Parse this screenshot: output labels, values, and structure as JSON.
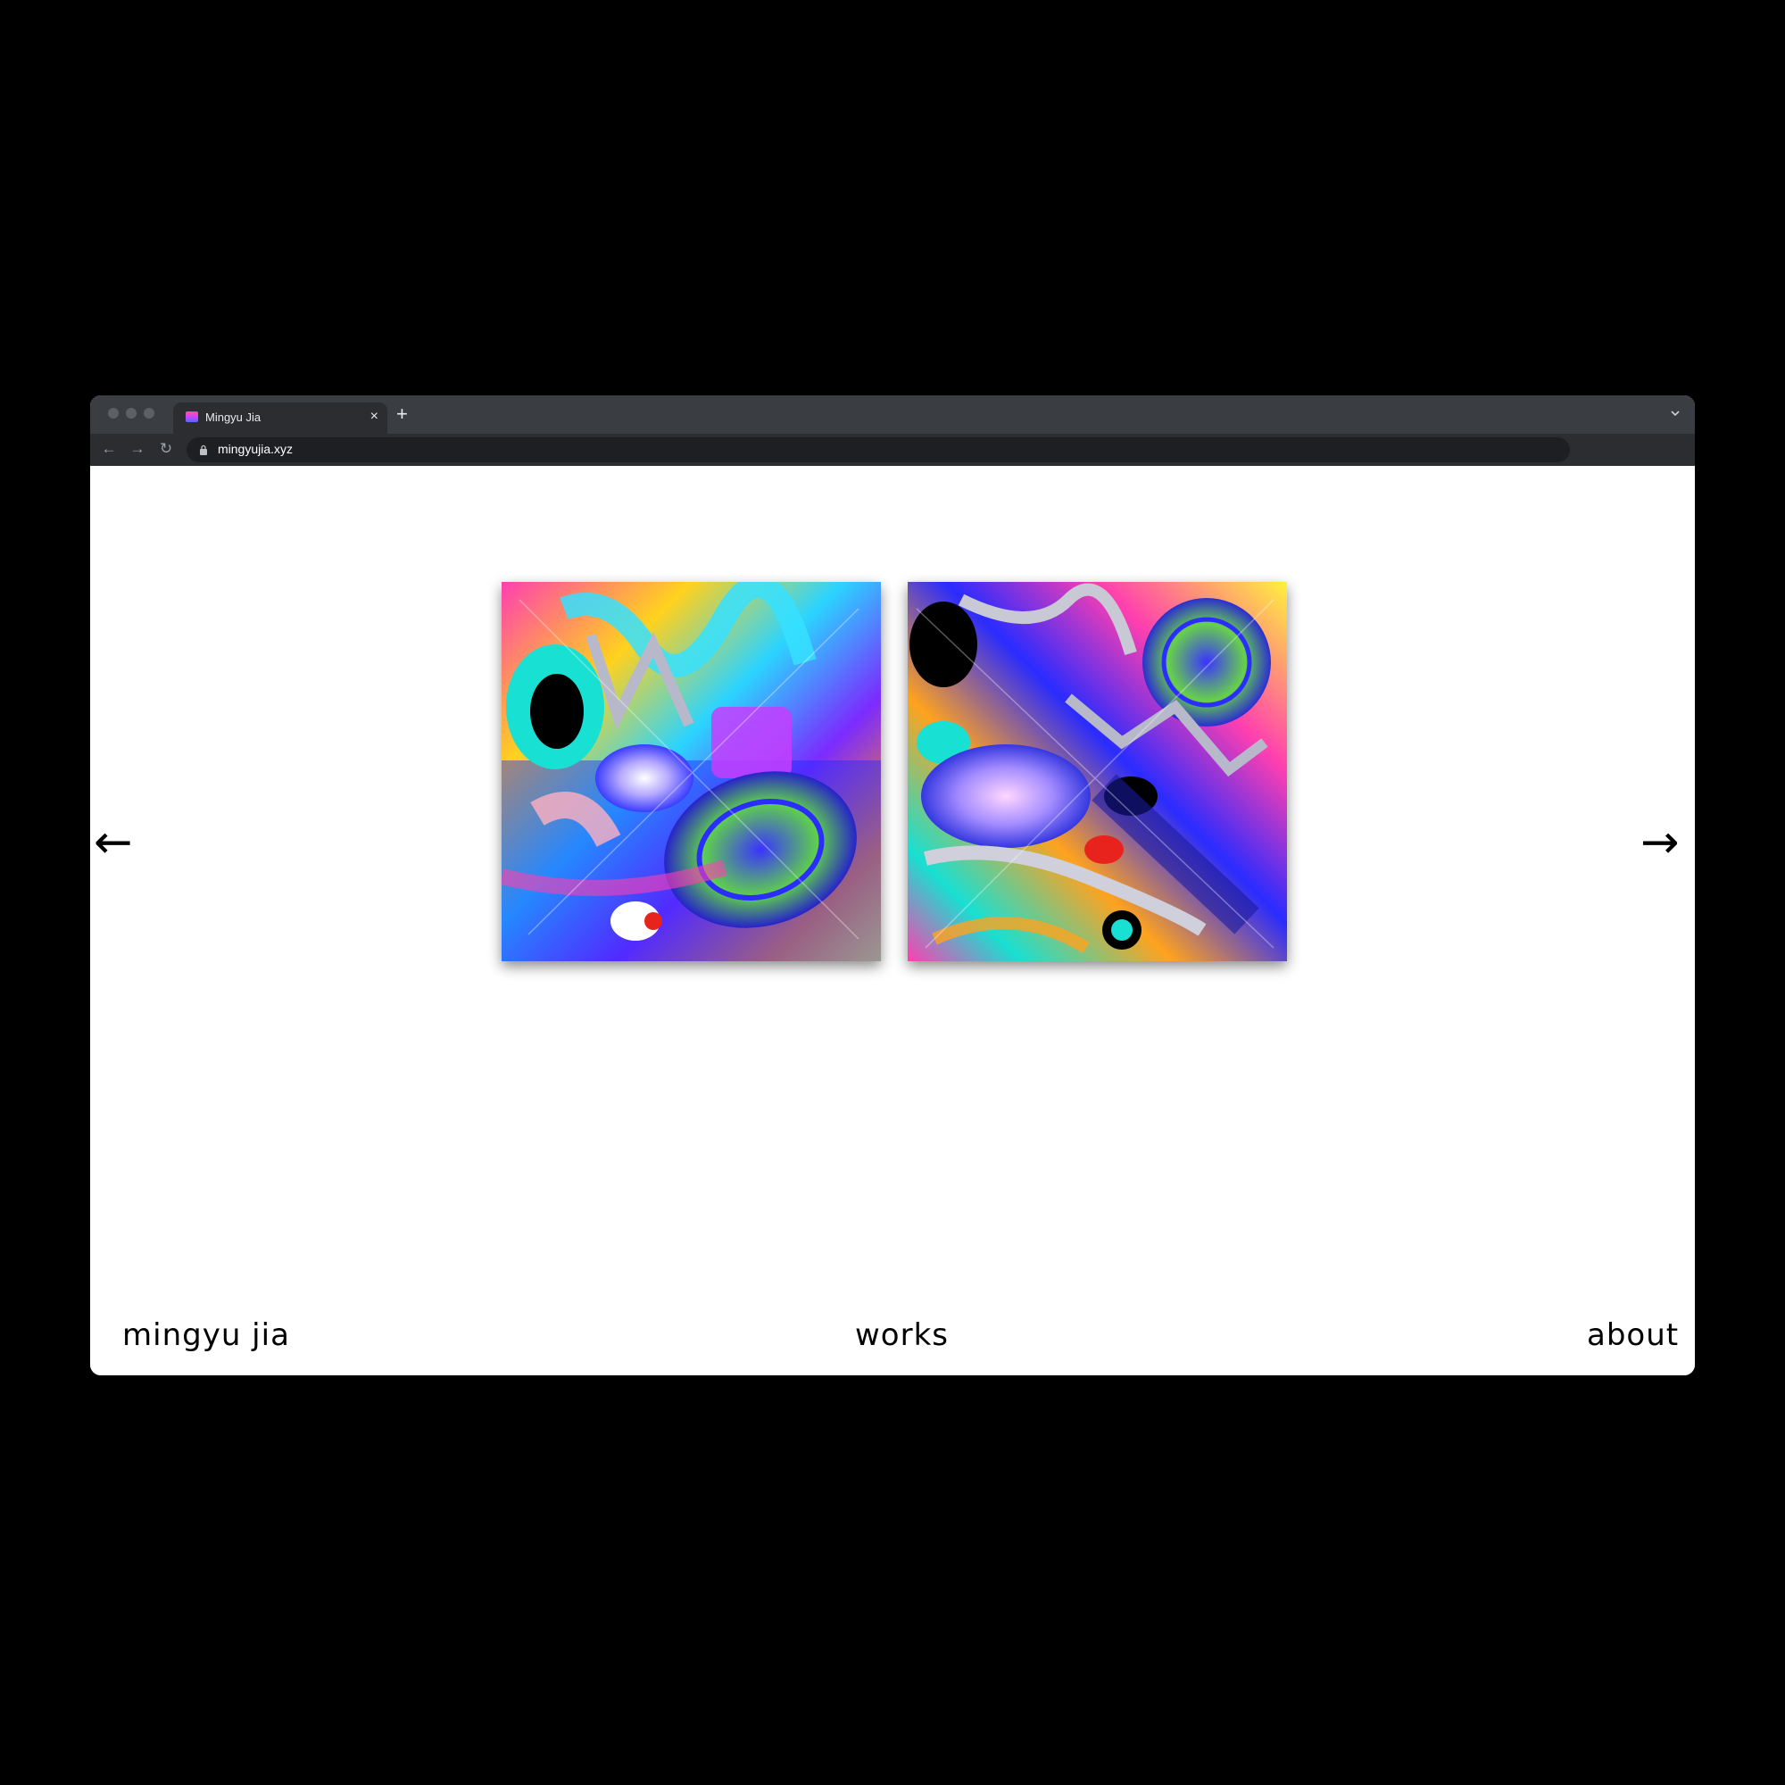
{
  "browser": {
    "tab_title": "Mingyu Jia",
    "tab_close": "×",
    "new_tab": "+",
    "url": "mingyujia.xyz",
    "back": "←",
    "forward": "→",
    "reload": "↻"
  },
  "gallery": {
    "prev_arrow": "←",
    "next_arrow": "→",
    "artworks": [
      {
        "alt": "psychedelic chrome artwork 1"
      },
      {
        "alt": "psychedelic chrome artwork 2"
      }
    ]
  },
  "nav": {
    "home": "mingyu jia",
    "works": "works",
    "about": "about"
  },
  "colors": {
    "page_bg": "#000000",
    "content_bg": "#ffffff",
    "chrome_tabbar": "#3a3d42",
    "chrome_toolbar": "#2b2d31"
  }
}
